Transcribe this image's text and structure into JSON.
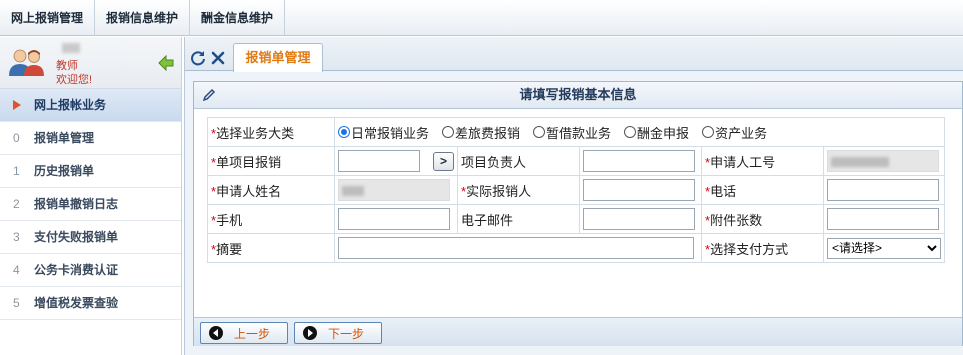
{
  "topmenu": [
    "网上报销管理",
    "报销信息维护",
    "酬金信息维护"
  ],
  "user": {
    "role": "教师",
    "welcome": "欢迎您!"
  },
  "sidebar": {
    "active": {
      "label": "网上报帐业务"
    },
    "items": [
      {
        "num": "0",
        "label": "报销单管理"
      },
      {
        "num": "1",
        "label": "历史报销单"
      },
      {
        "num": "2",
        "label": "报销单撤销日志"
      },
      {
        "num": "3",
        "label": "支付失败报销单"
      },
      {
        "num": "4",
        "label": "公务卡消费认证"
      },
      {
        "num": "5",
        "label": "增值税发票查验"
      }
    ]
  },
  "tab": {
    "label": "报销单管理"
  },
  "panel": {
    "title": "请填写报销基本信息"
  },
  "form": {
    "business_type_label": "选择业务大类",
    "business_types": [
      {
        "label": "日常报销业务",
        "selected": true
      },
      {
        "label": "差旅费报销",
        "selected": false
      },
      {
        "label": "暂借款业务",
        "selected": false
      },
      {
        "label": "酬金申报",
        "selected": false
      },
      {
        "label": "资产业务",
        "selected": false
      }
    ],
    "single_item_label": "单项目报销",
    "pick_button": ">",
    "project_owner_label": "项目负责人",
    "applicant_id_label": "申请人工号",
    "applicant_name_label": "申请人姓名",
    "actual_reimburser_label": "实际报销人",
    "phone_label": "电话",
    "mobile_label": "手机",
    "email_label": "电子邮件",
    "attachments_label": "附件张数",
    "summary_label": "摘要",
    "payment_method_label": "选择支付方式",
    "payment_method_value": "<请选择>",
    "required_mark": "*"
  },
  "footer": {
    "prev_label": "上一步",
    "next_label": "下一步"
  },
  "colors": {
    "accent": "#e07b14",
    "required": "#d0021b",
    "welcome": "#c0392b",
    "active_nav": "#c9d9ee"
  }
}
